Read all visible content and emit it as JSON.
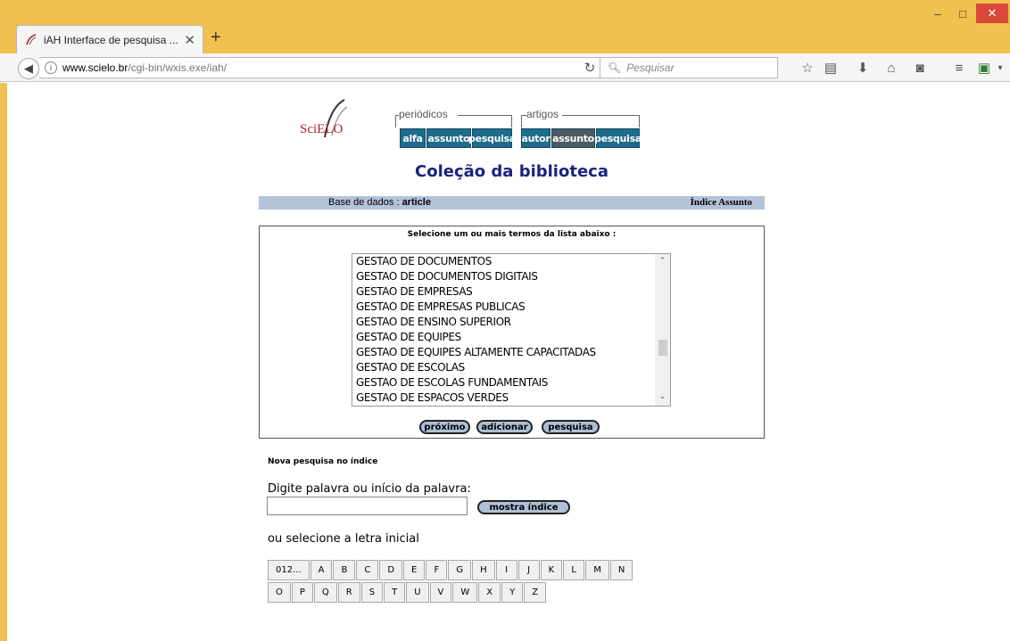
{
  "browser": {
    "tab_title": "iAH Interface de pesquisa ...",
    "new_tab_symbol": "+",
    "url_domain": "www.scielo.br",
    "url_path": "/cgi-bin/wxis.exe/iah/",
    "search_placeholder": "Pesquisar",
    "window_controls": {
      "minimize": "–",
      "maximize": "□",
      "close": "✕"
    },
    "toolbar_icons": [
      "reload-icon",
      "bookmark-star-icon",
      "reading-list-icon",
      "download-icon",
      "home-icon",
      "pocket-icon",
      "menu-icon",
      "extension-icon"
    ],
    "accent_color": "#f1c14f"
  },
  "header": {
    "logo_text": "SciELO",
    "groups": [
      {
        "label": "periódicos",
        "buttons": [
          "alfa",
          "assunto",
          "pesquisa"
        ]
      },
      {
        "label": "artigos",
        "buttons": [
          "autor",
          "assunto",
          "pesquisa"
        ]
      }
    ],
    "button_color": "#1f6b8b",
    "selected_button_color": "#4d5a62"
  },
  "page": {
    "title": "Coleção da biblioteca",
    "db_label": "Base de dados : ",
    "db_value": "article",
    "index_label": "Índice Assunto"
  },
  "selection": {
    "instruction": "Selecione um ou mais termos da lista abaixo :",
    "items": [
      "GESTAO DE DOCUMENTOS",
      "GESTAO DE DOCUMENTOS DIGITAIS",
      "GESTAO DE EMPRESAS",
      "GESTAO DE EMPRESAS PUBLICAS",
      "GESTAO DE ENSINO SUPERIOR",
      "GESTAO DE EQUIPES",
      "GESTAO DE EQUIPES ALTAMENTE CAPACITADAS",
      "GESTAO DE ESCOLAS",
      "GESTAO DE ESCOLAS FUNDAMENTAIS",
      "GESTAO DE ESPACOS VERDES"
    ],
    "buttons": {
      "next": "próximo",
      "add": "adicionar",
      "search": "pesquisa"
    }
  },
  "new_search": {
    "heading": "Nova pesquisa no índice",
    "prompt": "Digite palavra ou início da palavra:",
    "input_value": "",
    "button": "mostra índice",
    "letter_prompt": "ou selecione a letra inicial",
    "letters_row1": [
      "012...",
      "A",
      "B",
      "C",
      "D",
      "E",
      "F",
      "G",
      "H",
      "I",
      "J",
      "K",
      "L",
      "M",
      "N"
    ],
    "letters_row2": [
      "O",
      "P",
      "Q",
      "R",
      "S",
      "T",
      "U",
      "V",
      "W",
      "X",
      "Y",
      "Z"
    ]
  }
}
